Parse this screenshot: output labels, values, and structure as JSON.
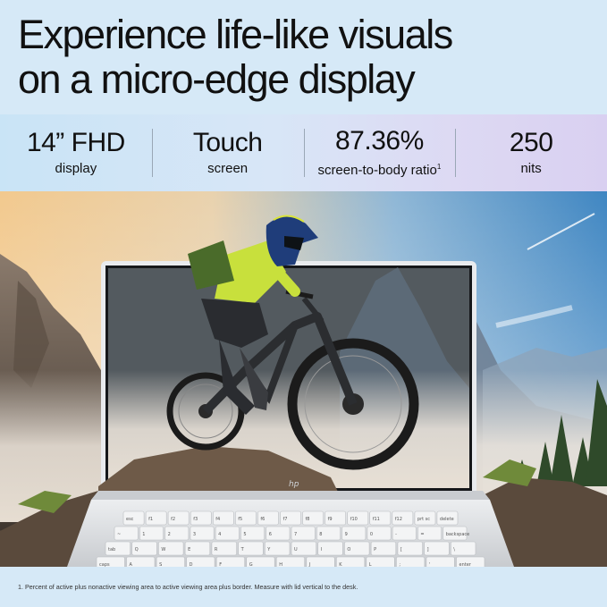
{
  "headline": {
    "line1": "Experience life-like visuals",
    "line2": "on a micro-edge display"
  },
  "specs": [
    {
      "value": "14” FHD",
      "label": "display",
      "footnote_mark": ""
    },
    {
      "value": "Touch",
      "label": "screen",
      "footnote_mark": ""
    },
    {
      "value": "87.36%",
      "label": "screen-to-body ratio",
      "footnote_mark": "1"
    },
    {
      "value": "250",
      "label": "nits",
      "footnote_mark": ""
    }
  ],
  "laptop": {
    "logo_text": "hp",
    "keyboard_rows": [
      [
        "esc",
        "f1",
        "f2",
        "f3",
        "f4",
        "f5",
        "f6",
        "f7",
        "f8",
        "f9",
        "f10",
        "f11",
        "f12",
        "prt sc",
        "delete"
      ],
      [
        "~",
        "1",
        "2",
        "3",
        "4",
        "5",
        "6",
        "7",
        "8",
        "9",
        "0",
        "-",
        "=",
        "backspace"
      ],
      [
        "tab",
        "Q",
        "W",
        "E",
        "R",
        "T",
        "Y",
        "U",
        "I",
        "O",
        "P",
        "[",
        "]",
        "\\"
      ],
      [
        "caps",
        "A",
        "S",
        "D",
        "F",
        "G",
        "H",
        "J",
        "K",
        "L",
        ";",
        "'",
        "enter"
      ]
    ]
  },
  "footnote": "1. Percent of active plus nonactive viewing area to active viewing area plus border. Measure with lid vertical to the desk.",
  "colors": {
    "background": "#d6e9f7",
    "text": "#111111",
    "laptop_silver": "#d9dadc"
  }
}
